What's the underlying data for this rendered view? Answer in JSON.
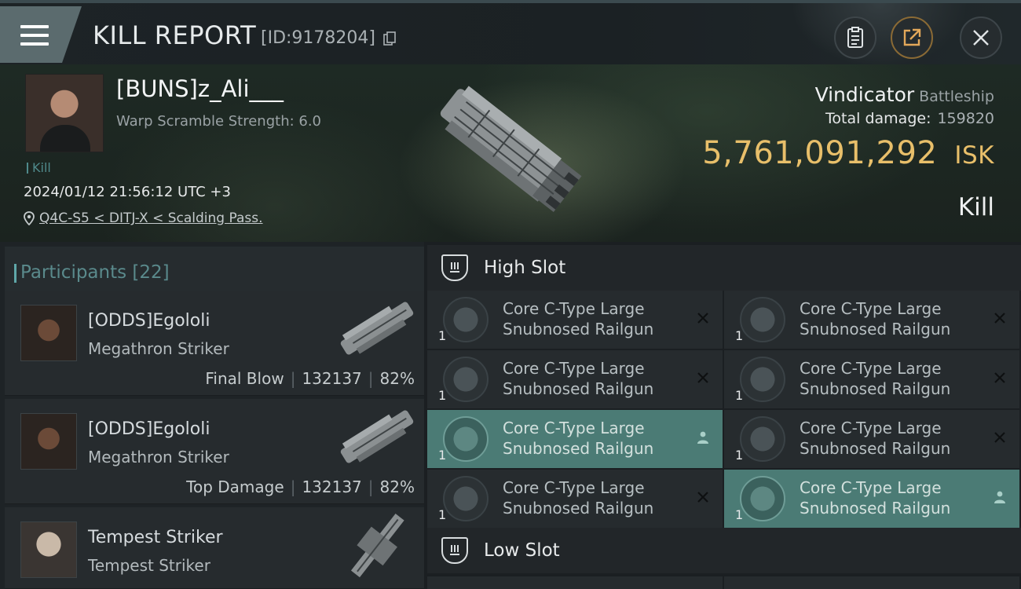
{
  "header": {
    "title": "KILL REPORT",
    "report_id": "[ID:9178204]"
  },
  "victim": {
    "pilot_name": "[BUNS]z_Ali___",
    "warp_scramble": "Warp Scramble Strength: 6.0",
    "kill_tag": "Kill",
    "datetime": "2024/01/12 21:56:12 UTC +3",
    "location": "Q4C-S5 < DITJ-X < Scalding Pass.",
    "ship_name": "Vindicator",
    "ship_class": "Battleship",
    "total_damage_label": "Total damage:",
    "total_damage_value": "159820",
    "isk_value": "5,761,091,292",
    "isk_unit": "ISK",
    "result": "Kill"
  },
  "participants": {
    "label": "Participants",
    "count": "[22]",
    "items": [
      {
        "name": "[ODDS]Egololi",
        "ship": "Megathron Striker",
        "role": "Final Blow",
        "damage": "132137",
        "percent": "82%"
      },
      {
        "name": "[ODDS]Egololi",
        "ship": "Megathron Striker",
        "role": "Top Damage",
        "damage": "132137",
        "percent": "82%"
      },
      {
        "name": "Tempest Striker",
        "ship": "Tempest Striker",
        "role": "",
        "damage": "",
        "percent": ""
      }
    ]
  },
  "fitting": {
    "high_slot_label": "High Slot",
    "low_slot_label": "Low Slot",
    "high_slots": [
      {
        "name": "Core C-Type Large Snubnosed Railgun",
        "qty": "1",
        "status": "destroyed"
      },
      {
        "name": "Core C-Type Large Snubnosed Railgun",
        "qty": "1",
        "status": "destroyed"
      },
      {
        "name": "Core C-Type Large Snubnosed Railgun",
        "qty": "1",
        "status": "destroyed"
      },
      {
        "name": "Core C-Type Large Snubnosed Railgun",
        "qty": "1",
        "status": "destroyed"
      },
      {
        "name": "Core C-Type Large Snubnosed Railgun",
        "qty": "1",
        "status": "dropped"
      },
      {
        "name": "Core C-Type Large Snubnosed Railgun",
        "qty": "1",
        "status": "destroyed"
      },
      {
        "name": "Core C-Type Large Snubnosed Railgun",
        "qty": "1",
        "status": "destroyed"
      },
      {
        "name": "Core C-Type Large Snubnosed Railgun",
        "qty": "1",
        "status": "dropped"
      }
    ]
  },
  "colors": {
    "isk_gold": "#e8bf6a",
    "accent_teal": "#5fa7a9",
    "dropped_green": "#4b7b75"
  }
}
